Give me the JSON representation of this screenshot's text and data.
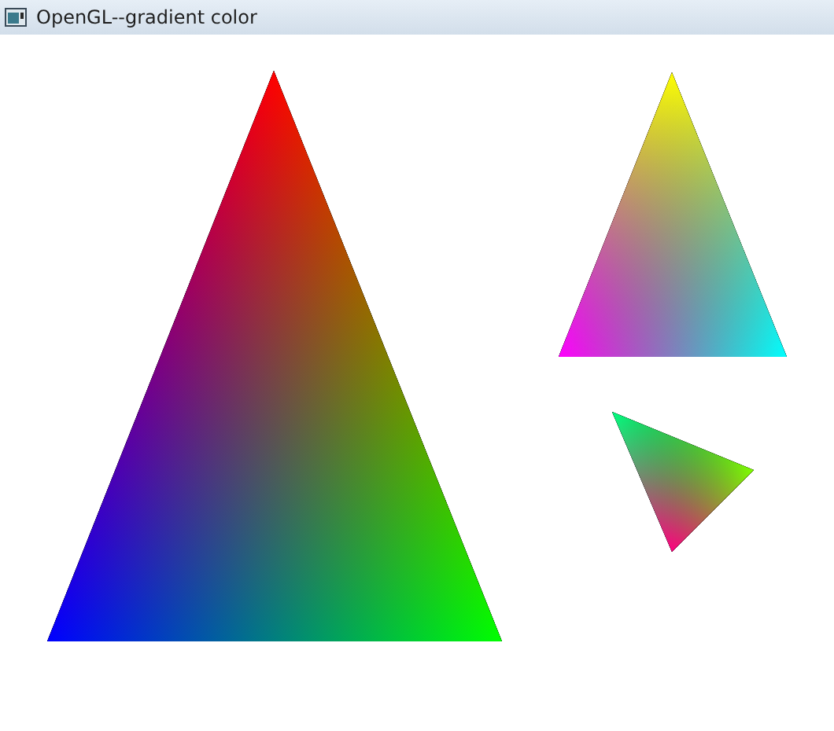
{
  "window": {
    "title": "OpenGL--gradient color"
  }
}
